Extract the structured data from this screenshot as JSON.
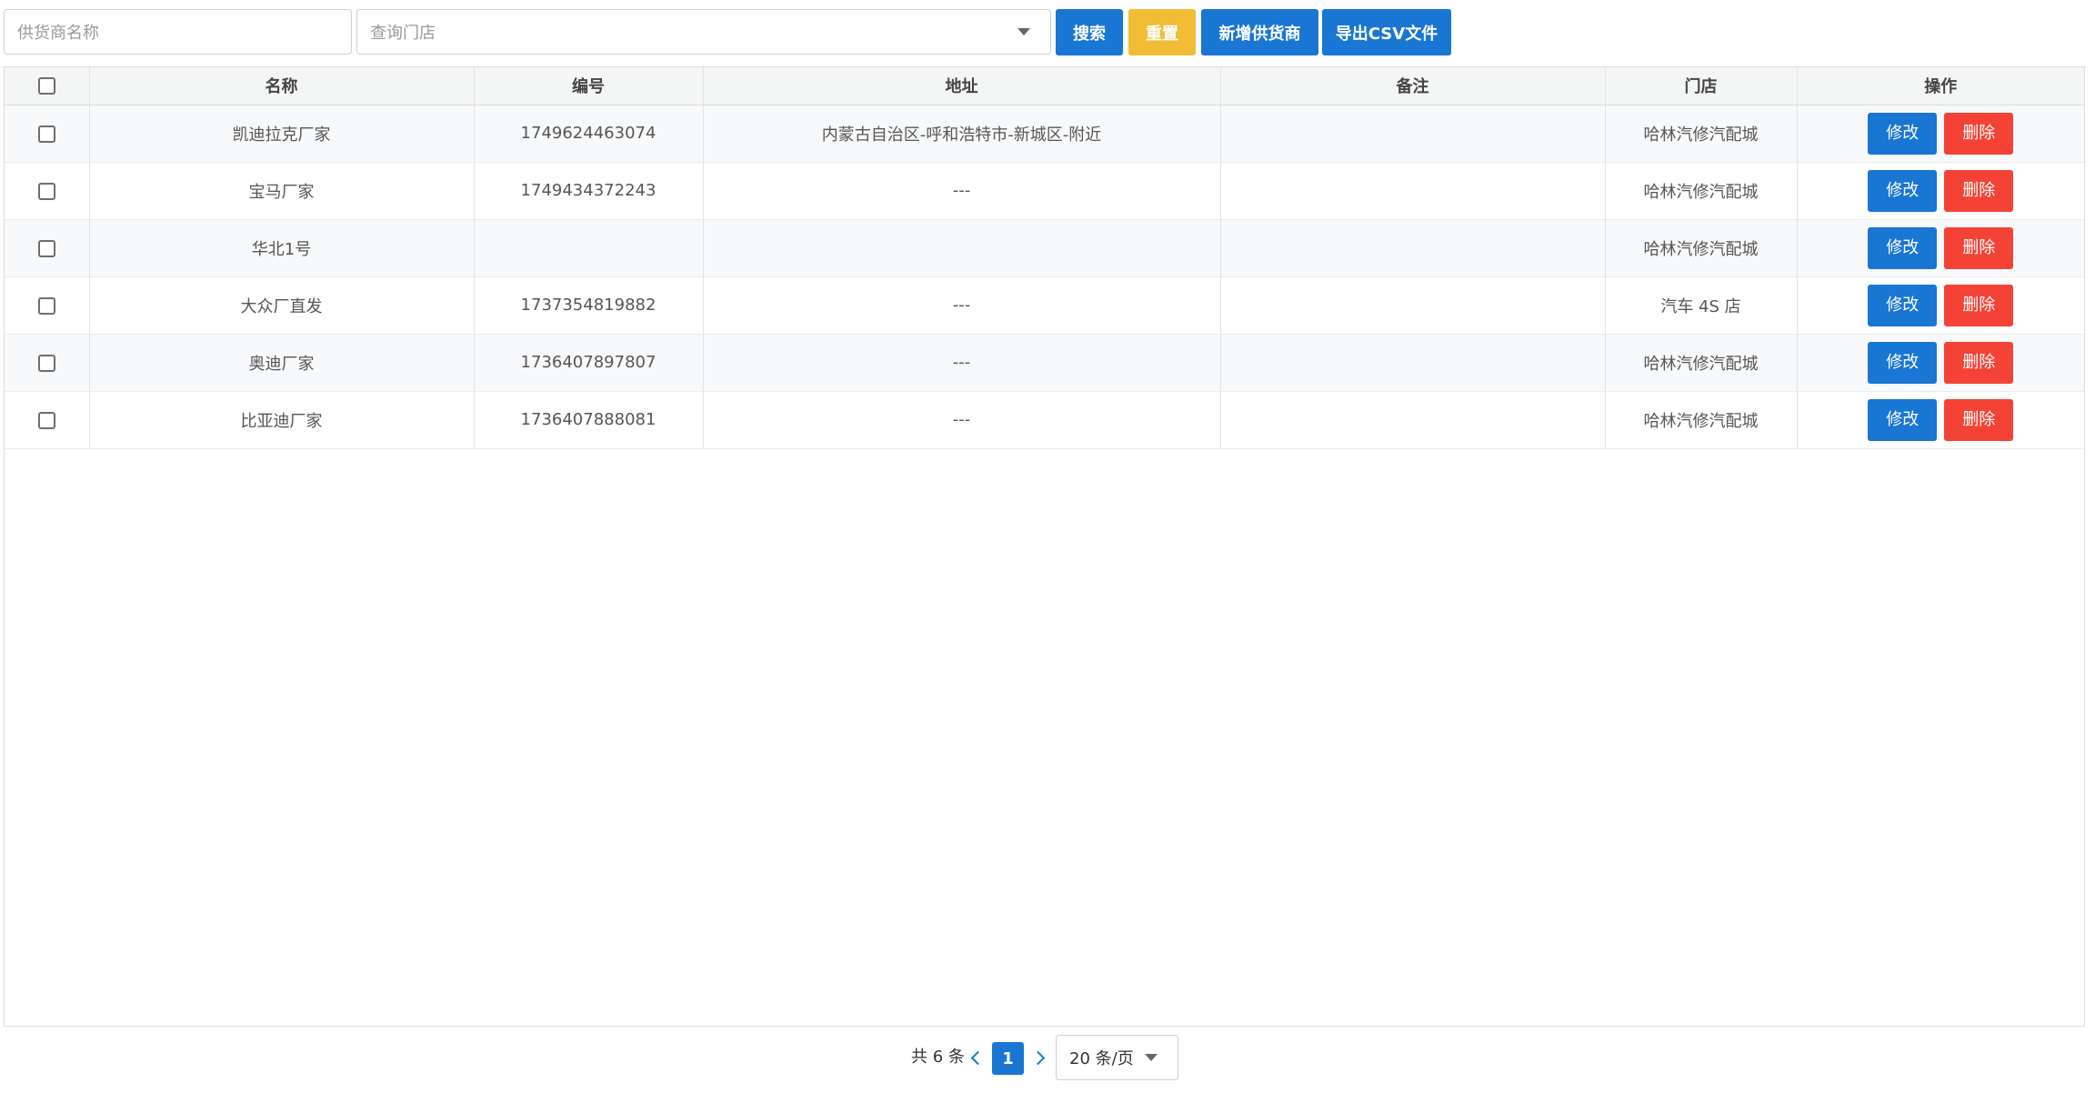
{
  "toolbar": {
    "supplier_placeholder": "供货商名称",
    "store_placeholder": "查询门店",
    "search_label": "搜索",
    "reset_label": "重置",
    "add_label": "新增供货商",
    "export_label": "导出CSV文件",
    "primary_color": "#1976d2",
    "warning_color": "#f0bd35"
  },
  "table": {
    "columns": [
      "名称",
      "编号",
      "地址",
      "备注",
      "门店",
      "操作"
    ],
    "edit_label": "修改",
    "delete_label": "删除",
    "delete_color": "#f44336",
    "rows": [
      {
        "name": "凯迪拉克厂家",
        "code": "1749624463074",
        "address": "内蒙古自治区-呼和浩特市-新城区-附近",
        "remark": "",
        "store": "哈林汽修汽配城"
      },
      {
        "name": "宝马厂家",
        "code": "1749434372243",
        "address": "---",
        "remark": "",
        "store": "哈林汽修汽配城"
      },
      {
        "name": "华北1号",
        "code": "",
        "address": "",
        "remark": "",
        "store": "哈林汽修汽配城"
      },
      {
        "name": "大众厂直发",
        "code": "1737354819882",
        "address": "---",
        "remark": "",
        "store": "汽车 4S 店"
      },
      {
        "name": "奥迪厂家",
        "code": "1736407897807",
        "address": "---",
        "remark": "",
        "store": "哈林汽修汽配城"
      },
      {
        "name": "比亚迪厂家",
        "code": "1736407888081",
        "address": "---",
        "remark": "",
        "store": "哈林汽修汽配城"
      }
    ]
  },
  "pagination": {
    "total_label": "共 6 条",
    "current_page": "1",
    "page_size_label": "20 条/页"
  }
}
